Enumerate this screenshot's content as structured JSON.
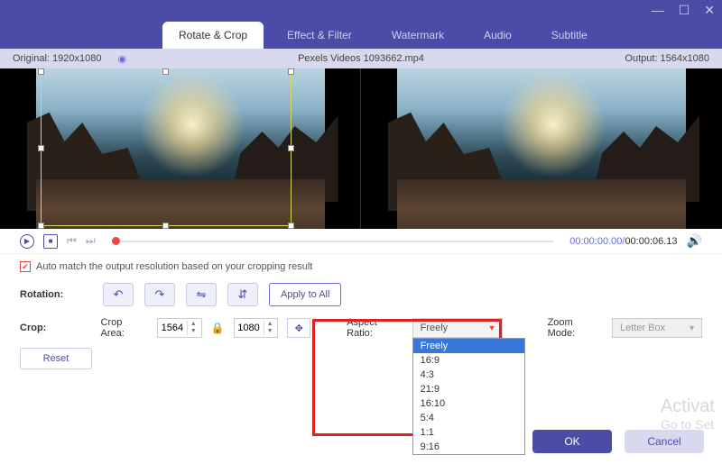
{
  "window": {
    "minimize": "—",
    "maximize": "☐",
    "close": "✕"
  },
  "tabs": [
    {
      "label": "Rotate & Crop",
      "active": true
    },
    {
      "label": "Effect & Filter",
      "active": false
    },
    {
      "label": "Watermark",
      "active": false
    },
    {
      "label": "Audio",
      "active": false
    },
    {
      "label": "Subtitle",
      "active": false
    }
  ],
  "infobar": {
    "original_label": "Original:  1920x1080",
    "filename": "Pexels Videos 1093662.mp4",
    "output_label": "Output: 1564x1080"
  },
  "playbar": {
    "current": "00:00:00.00",
    "duration": "00:00:06.13",
    "sep": "/"
  },
  "automatch": {
    "checked": true,
    "label": "Auto match the output resolution based on your cropping result"
  },
  "rotation": {
    "label": "Rotation:",
    "apply_all": "Apply to All"
  },
  "crop": {
    "label": "Crop:",
    "area_label": "Crop Area:",
    "width": "1564",
    "height": "1080",
    "aspect_label": "Aspect Ratio:",
    "aspect_selected": "Freely",
    "aspect_options": [
      "Freely",
      "16:9",
      "4:3",
      "21:9",
      "16:10",
      "5:4",
      "1:1",
      "9:16"
    ],
    "zoom_label": "Zoom Mode:",
    "zoom_selected": "Letter Box"
  },
  "reset": {
    "label": "Reset"
  },
  "footer": {
    "ok": "OK",
    "cancel": "Cancel"
  },
  "watermark": {
    "line1": "Activat",
    "line2": "Go to Set"
  }
}
